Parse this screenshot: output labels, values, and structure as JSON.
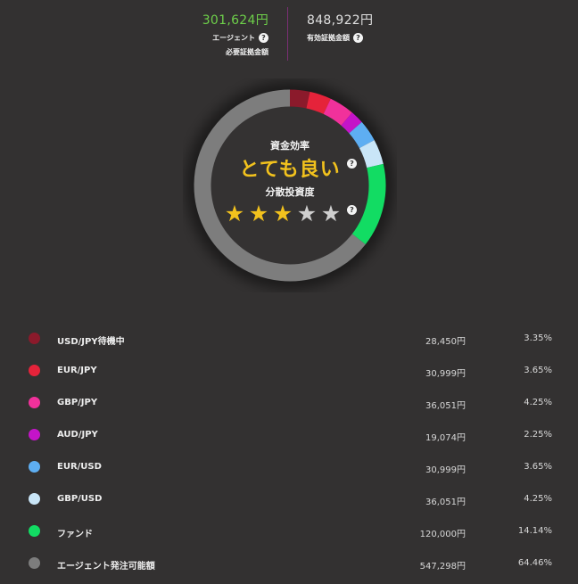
{
  "summary": {
    "agent_amount": "301,624円",
    "agent_label": "エージェント",
    "agent_sublabel": "必要証拠金額",
    "valid_amount": "848,922円",
    "valid_label": "有効証拠金額",
    "help_glyph": "?"
  },
  "efficiency": {
    "label": "資金効率",
    "value": "とても良い",
    "diversification_label": "分散投資度",
    "stars_total": 5,
    "stars_filled": 3,
    "star_glyph": "★"
  },
  "chart_data": {
    "type": "pie",
    "style": "donut",
    "categories": [
      "USD/JPY待機中",
      "EUR/JPY",
      "GBP/JPY",
      "AUD/JPY",
      "EUR/USD",
      "GBP/USD",
      "ファンド",
      "エージェント発注可能額"
    ],
    "values": [
      3.35,
      3.65,
      4.25,
      2.25,
      3.65,
      4.25,
      14.14,
      64.46
    ],
    "colors": [
      "#8b1a2b",
      "#e5233a",
      "#f1319b",
      "#c414c8",
      "#5eaef2",
      "#c9e5f7",
      "#12dc63",
      "#7d7d7d"
    ]
  },
  "legend": [
    {
      "name": "USD/JPY待機中",
      "amount": "28,450円",
      "pct": "3.35%",
      "color": "#8b1a2b"
    },
    {
      "name": "EUR/JPY",
      "amount": "30,999円",
      "pct": "3.65%",
      "color": "#e5233a"
    },
    {
      "name": "GBP/JPY",
      "amount": "36,051円",
      "pct": "4.25%",
      "color": "#f1319b"
    },
    {
      "name": "AUD/JPY",
      "amount": "19,074円",
      "pct": "2.25%",
      "color": "#c414c8"
    },
    {
      "name": "EUR/USD",
      "amount": "30,999円",
      "pct": "3.65%",
      "color": "#5eaef2"
    },
    {
      "name": "GBP/USD",
      "amount": "36,051円",
      "pct": "4.25%",
      "color": "#c9e5f7"
    },
    {
      "name": "ファンド",
      "amount": "120,000円",
      "pct": "14.14%",
      "color": "#12dc63"
    },
    {
      "name": "エージェント発注可能額",
      "amount": "547,298円",
      "pct": "64.46%",
      "color": "#7d7d7d"
    }
  ]
}
